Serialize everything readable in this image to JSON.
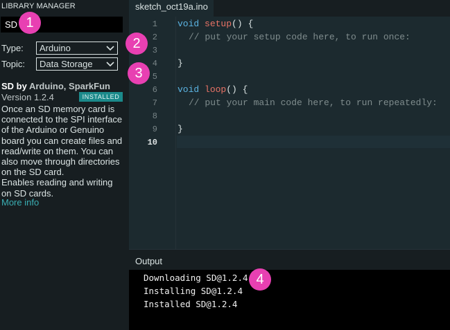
{
  "library": {
    "panel_title": "LIBRARY MANAGER",
    "search_value": "SD",
    "type_label": "Type:",
    "type_value": "Arduino",
    "topic_label": "Topic:",
    "topic_value": "Data Storage",
    "entry": {
      "name": "SD",
      "by": " by ",
      "authors": "Arduino, SparkFun",
      "version": "Version 1.2.4",
      "badge": "INSTALLED",
      "description_lines": [
        "Once an SD memory card is",
        "connected to the SPI interface",
        "of the Arduino or Genuino",
        "board you can create files and",
        "read/write on them. You can",
        "also move through directories",
        "on the SD card.",
        "Enables reading and writing",
        "on SD cards."
      ],
      "more_info": "More info"
    }
  },
  "editor": {
    "tab_name": "sketch_oct19a.ino",
    "line_numbers": [
      "1",
      "2",
      "3",
      "4",
      "5",
      "6",
      "7",
      "8",
      "9",
      "10"
    ],
    "current_line": "10",
    "code": {
      "l1_kw": "void",
      "l1_fn": "setup",
      "l1_rest": "() {",
      "l2_comment": "// put your setup code here, to run once:",
      "l4": "}",
      "l6_kw": "void",
      "l6_fn": "loop",
      "l6_rest": "() {",
      "l7_comment": "// put your main code here, to run repeatedly:",
      "l9": "}"
    }
  },
  "output": {
    "label": "Output",
    "lines": [
      "Downloading SD@1.2.4",
      "Installing SD@1.2.4",
      "Installed SD@1.2.4"
    ]
  },
  "markers": [
    "1",
    "2",
    "3",
    "4"
  ],
  "colors": {
    "marker": "#e840b2",
    "badge": "#1b8a8b",
    "link": "#3aaeb3",
    "keyword": "#5cb5e4",
    "function": "#e97366"
  }
}
